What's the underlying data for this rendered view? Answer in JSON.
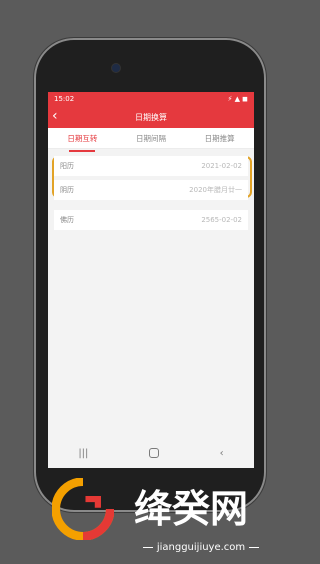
{
  "status_bar": {
    "time": "15:02",
    "icons": "⚡ ▲ ◼"
  },
  "header": {
    "title": "日期换算",
    "back_icon": "chevron-left-icon"
  },
  "tabs": [
    {
      "label": "日期互转",
      "active": true
    },
    {
      "label": "日期间隔",
      "active": false
    },
    {
      "label": "日期推算",
      "active": false
    }
  ],
  "rows": [
    {
      "label": "阳历",
      "value": "2021-02-02"
    },
    {
      "label": "阴历",
      "value": "2020年腊月廿一"
    },
    {
      "label": "佛历",
      "value": "2565-02-02"
    }
  ],
  "highlight_color": "#e2a327",
  "navigation": {
    "recent_icon": "recent-apps-icon",
    "home_icon": "home-icon",
    "back_icon": "back-icon"
  },
  "watermark": {
    "title": "绛癸网",
    "url": "jiangguijiuye.com"
  }
}
